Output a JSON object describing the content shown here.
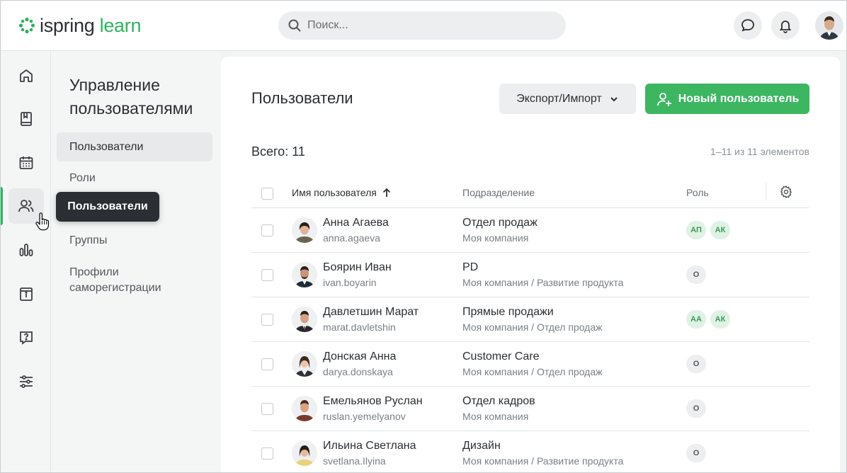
{
  "header": {
    "logo_main": "ispring",
    "logo_accent": "learn",
    "search_placeholder": "Поиск..."
  },
  "sidebar": {
    "title": "Управление пользователями",
    "items": [
      {
        "label": "Пользователи"
      },
      {
        "label": "Роли"
      },
      {
        "label": "Группы"
      },
      {
        "label": "Профили саморегистрации"
      }
    ],
    "tooltip": "Пользователи"
  },
  "main": {
    "title": "Пользователи",
    "export_label": "Экспорт/Импорт",
    "new_user_label": "Новый пользователь",
    "total": "Всего: 11",
    "pager": "1–11 из 11 элементов",
    "columns": {
      "name": "Имя пользователя",
      "dept": "Подразделение",
      "role": "Роль"
    },
    "rows": [
      {
        "name": "Анна Агаева",
        "login": "anna.agaeva",
        "dept": "Отдел продаж",
        "path": "Моя компания",
        "roles": [
          "АП",
          "АК"
        ]
      },
      {
        "name": "Боярин Иван",
        "login": "ivan.boyarin",
        "dept": "PD",
        "path": "Моя компания / Развитие продукта",
        "roles": [
          "О"
        ]
      },
      {
        "name": "Давлетшин Марат",
        "login": "marat.davletshin",
        "dept": "Прямые продажи",
        "path": "Моя компания / Отдел продаж",
        "roles": [
          "АА",
          "АК"
        ]
      },
      {
        "name": "Донская Анна",
        "login": "darya.donskaya",
        "dept": "Customer Care",
        "path": "Моя компания / Отдел продаж",
        "roles": [
          "О"
        ]
      },
      {
        "name": "Емельянов Руслан",
        "login": "ruslan.yemelyanov",
        "dept": "Отдел кадров",
        "path": "Моя компания",
        "roles": [
          "О"
        ]
      },
      {
        "name": "Ильина Светлана",
        "login": "svetlana.Ilyina",
        "dept": "Дизайн",
        "path": "Моя компания / Развитие продукта",
        "roles": [
          "О"
        ]
      }
    ]
  },
  "colors": {
    "brand_green": "#2fb35f",
    "button_green": "#3db662",
    "role_green_bg": "#dff2e5",
    "tooltip_bg": "#2b2f33"
  },
  "icons": {
    "rail": [
      "home-icon",
      "book-icon",
      "calendar-icon",
      "users-icon",
      "reports-icon",
      "info-icon",
      "question-icon",
      "settings-sliders-icon"
    ],
    "header": [
      "search-icon",
      "chat-icon",
      "bell-icon"
    ],
    "table": [
      "sort-arrow-up-icon",
      "gear-icon"
    ]
  }
}
